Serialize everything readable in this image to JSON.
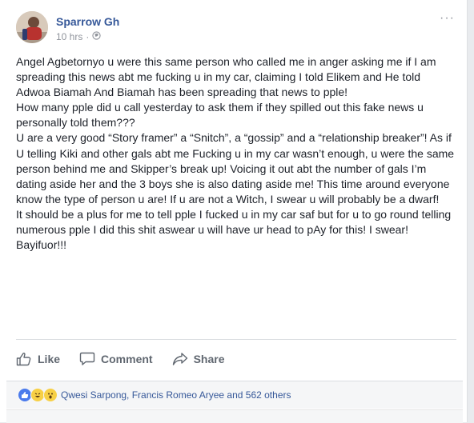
{
  "post": {
    "author": "Sparrow Gh",
    "time": "10 hrs",
    "separator": "·",
    "more_glyph": "···",
    "paragraphs": [
      "Angel Agbetornyo u were this same person who called me in anger asking me if I am spreading this news abt me fucking u in my car, claiming I told Elikem and He told Adwoa Biamah And Biamah has been spreading that news to pple!",
      "How many pple did u call yesterday to ask them if they spilled out this fake news u personally told them???",
      "U are a very good “Story framer” a “Snitch”, a “gossip” and a “relationship breaker”! As if U telling Kiki and other gals abt me Fucking u in my car wasn’t enough, u were the same person behind me and Skipper’s break up! Voicing it out abt the number of gals I’m dating aside her and the 3 boys she is also dating aside me! This time around everyone know the type of person u are! If u are not a Witch, I swear u will probably be a dwarf!",
      "It should be a plus for me to tell pple I fucked u in my car saf but for u to go round telling numerous pple I did this shit aswear u will have ur head to pAy for this! I swear!",
      "Bayifuor!!!"
    ]
  },
  "actions": {
    "like": "Like",
    "comment": "Comment",
    "share": "Share"
  },
  "reactions": {
    "summary": "Qwesi Sarpong, Francis Romeo Aryee and 562 others",
    "types": [
      "like",
      "haha",
      "wow"
    ]
  },
  "colors": {
    "link_blue": "#365899",
    "meta_gray": "#90949c",
    "action_gray": "#606770",
    "like_blue": "#4b7bec",
    "reaction_yellow": "#f7d046"
  }
}
